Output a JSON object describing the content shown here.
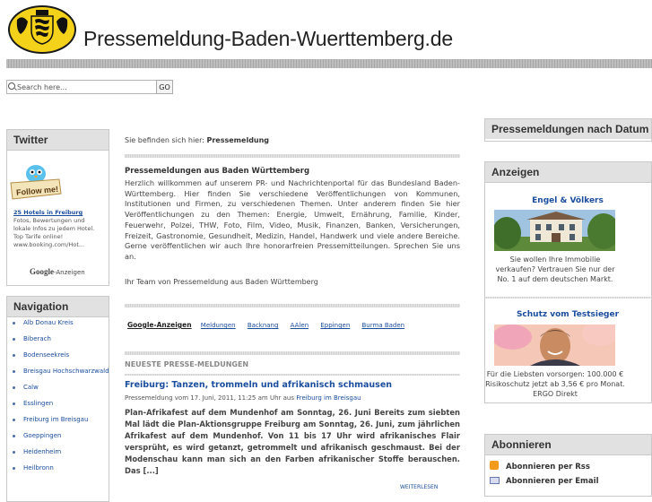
{
  "header": {
    "site_title": "Pressemeldung-Baden-Wuerttemberg.de",
    "logo_icon": "coat-of-arms-logo"
  },
  "search": {
    "placeholder": "Search here...",
    "button_label": "GO"
  },
  "twitter": {
    "title": "Twitter",
    "badge_text": "Follow me!",
    "ad_link": "25 Hotels in Freiburg",
    "ad_text": "Fotos, Bewertungen und lokale Infos zu jedem Hotel. Top Tarife online! www.booking.com/Hot...",
    "google_label": "Google",
    "google_suffix": "-Anzeigen"
  },
  "navigation": {
    "title": "Navigation",
    "items": [
      "Alb Donau Kreis",
      "Biberach",
      "Bodenseekreis",
      "Breisgau Hochschwarzwald",
      "Calw",
      "Esslingen",
      "Freiburg im Breisgau",
      "Goeppingen",
      "Heidenheim",
      "Heilbronn"
    ]
  },
  "main": {
    "breadcrumb_prefix": "Sie befinden sich hier:",
    "breadcrumb_current": "Pressemeldung",
    "intro_title": "Pressemeldungen aus Baden Württemberg",
    "intro_text": "Herzlich willkommen auf unserem PR- und Nachrichtenportal für das Bundesland Baden-Württemberg. Hier finden Sie verschiedene Veröffentlichungen von Kommunen, Institutionen und Firmen, zu verschiedenen Themen. Unter anderem finden Sie hier Veröffentlichungen zu den Themen: Energie, Umwelt, Ernährung, Familie, Kinder, Feuerwehr, Polzei, THW, Foto, Film, Video, Musik, Finanzen, Banken, Versicherungen, Freizeit, Gastronomie, Gesundheit, Medizin, Handel, Handwerk und viele andere Bereiche. Gerne veröffentlichen wir auch Ihre honorarfreien Pressemitteilungen. Sprechen Sie uns an.",
    "team_line": "Ihr Team von Pressemeldung aus Baden Württemberg",
    "ad_links_label": "Google-Anzeigen",
    "ad_links": [
      "Meldungen",
      "Backnang",
      "AAlen",
      "Eppingen",
      "Burma Baden"
    ],
    "news_heading": "NEUESTE PRESSE-MELDUNGEN",
    "news_title": "Freiburg: Tanzen, trommeln und afrikanisch schmausen",
    "news_meta": "Pressemeldung vom 17. Juni, 2011, 11:25 am Uhr aus",
    "news_meta_link": "Freiburg im Breisgau",
    "news_body": "Plan-Afrikafest auf dem Mundenhof am Sonntag, 26. Juni Bereits zum siebten Mal lädt die Plan-Aktionsgruppe Freiburg am Sonntag, 26. Juni, zum jährlichen Afrikafest auf dem Mundenhof. Von 11 bis 17 Uhr wird afrikanisches Flair versprüht, es wird getanzt, getrommelt und afrikanisch geschmaust. Bei der Modenschau kann man sich an den Farben afrikanischer Stoffe berauschen. Das [...]",
    "more_link": "WEITERLESEN"
  },
  "right": {
    "by_date_title": "Pressemeldungen nach Datum",
    "ads_title": "Anzeigen",
    "ad1_title": "Engel & Völkers",
    "ad1_text": "Sie wollen Ihre Immobilie verkaufen? Vertrauen Sie nur der No. 1 auf dem deutschen Markt.",
    "ad2_title": "Schutz vom Testsieger",
    "ad2_text": "Für die Liebsten vorsorgen: 100.000 € Risikoschutz jetzt ab 3,56 € pro Monat. ERGO Direkt",
    "subscribe_title": "Abonnieren",
    "subscribe_rss": "Abonnieren per Rss",
    "subscribe_email": "Abonnieren per Email"
  }
}
